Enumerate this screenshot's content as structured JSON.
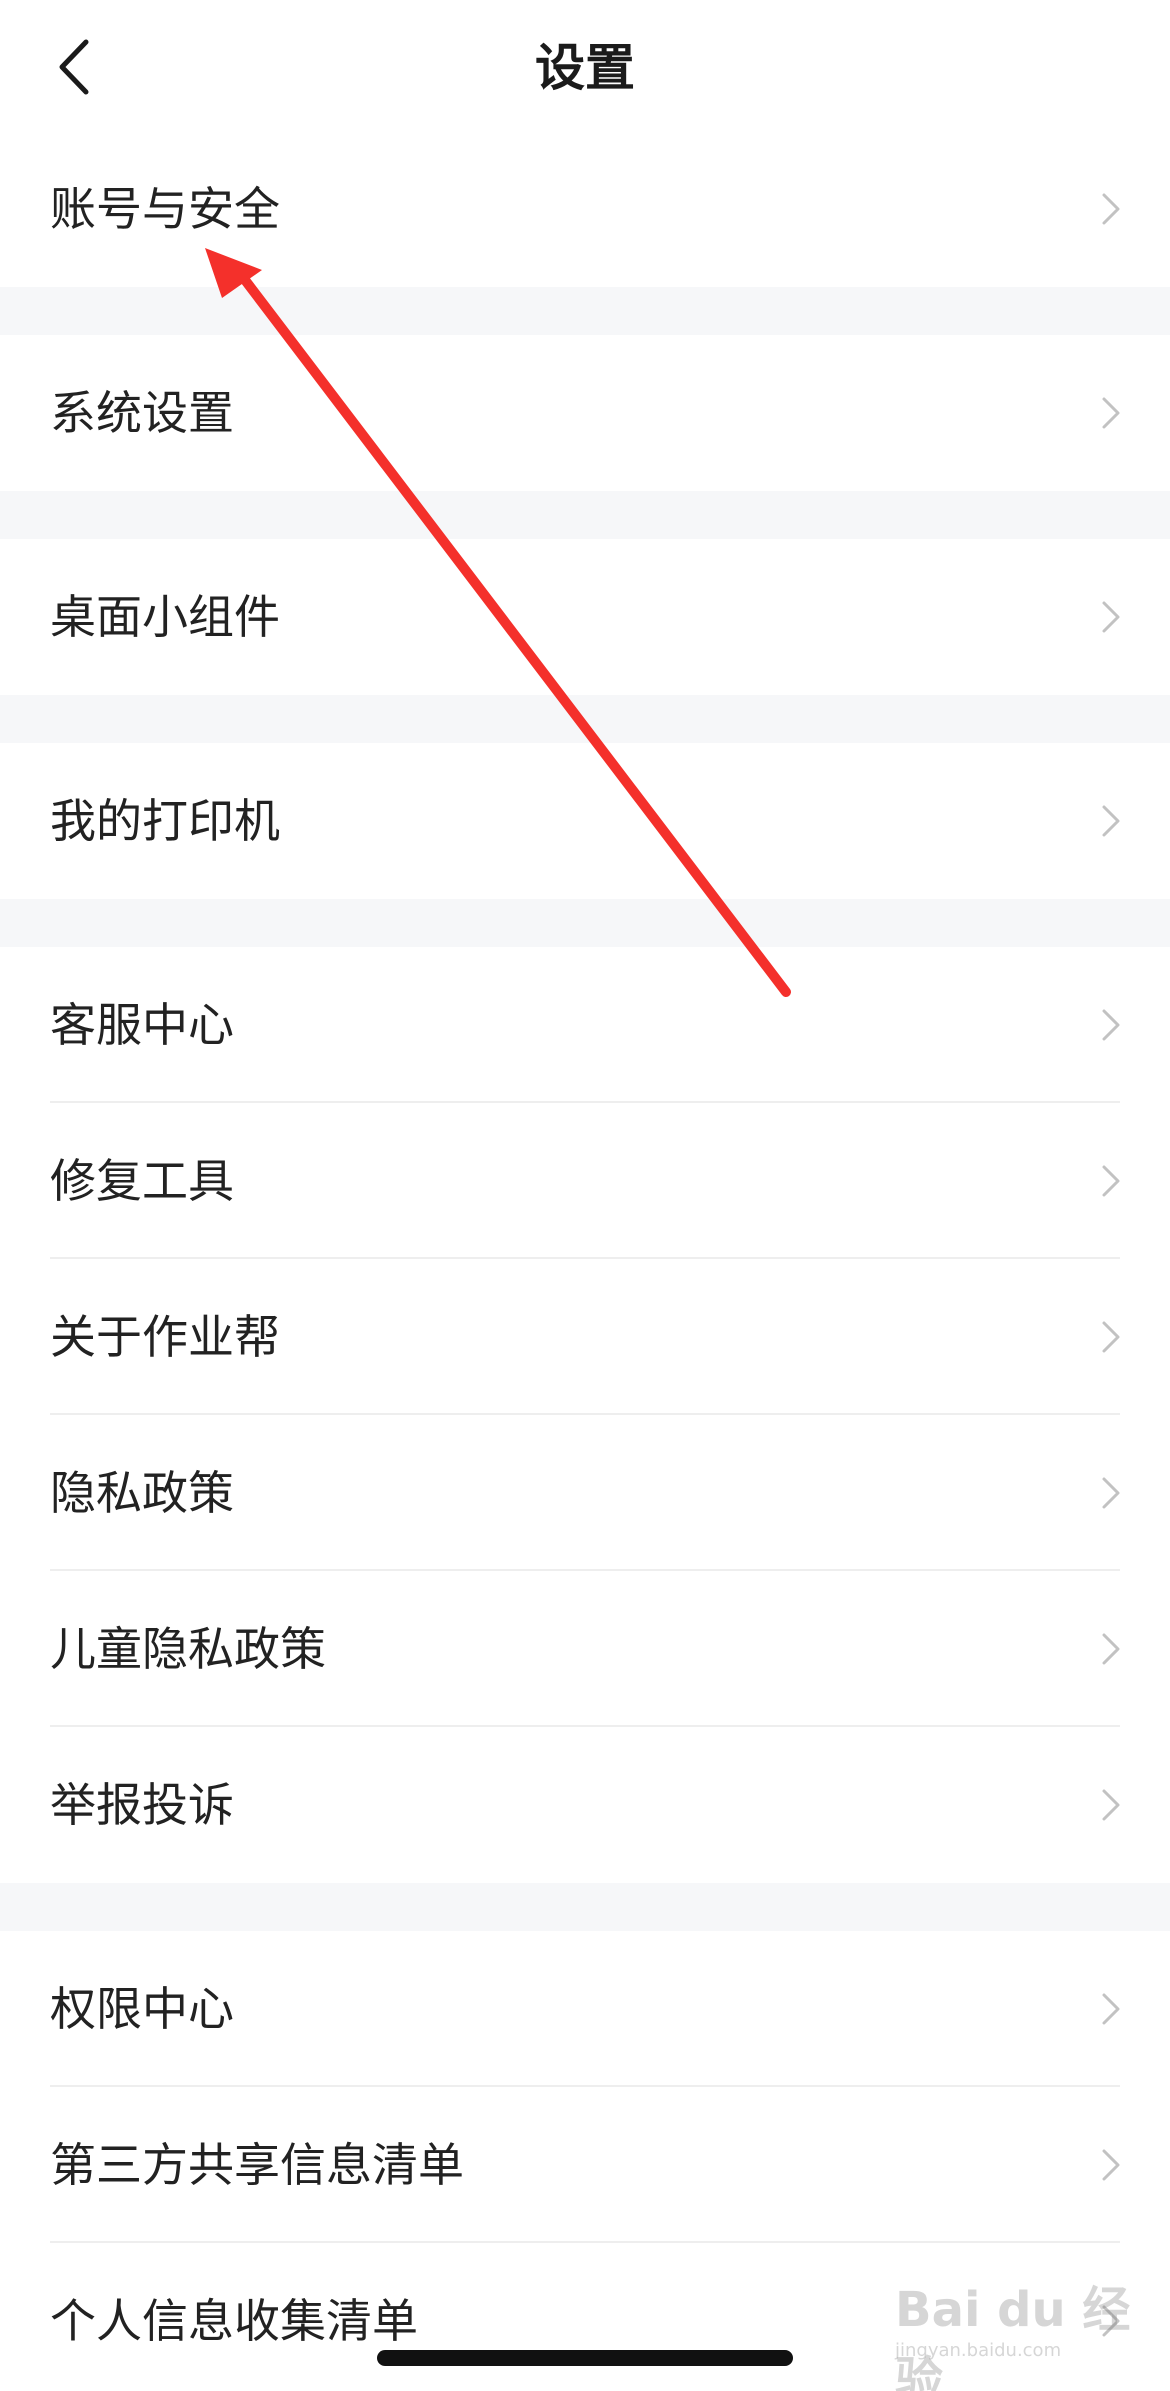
{
  "header": {
    "title": "设置"
  },
  "groups": [
    {
      "items": [
        {
          "label": "账号与安全"
        }
      ]
    },
    {
      "items": [
        {
          "label": "系统设置"
        }
      ]
    },
    {
      "items": [
        {
          "label": "桌面小组件"
        }
      ]
    },
    {
      "items": [
        {
          "label": "我的打印机"
        }
      ]
    },
    {
      "items": [
        {
          "label": "客服中心"
        },
        {
          "label": "修复工具"
        },
        {
          "label": "关于作业帮"
        },
        {
          "label": "隐私政策"
        },
        {
          "label": "儿童隐私政策"
        },
        {
          "label": "举报投诉"
        }
      ]
    },
    {
      "items": [
        {
          "label": "权限中心"
        },
        {
          "label": "第三方共享信息清单"
        },
        {
          "label": "个人信息收集清单"
        }
      ]
    }
  ],
  "watermark": {
    "logo": "Bai du 经验",
    "domain": "jingyan.baidu.com"
  },
  "colors": {
    "background": "#ffffff",
    "section_gap": "#f6f7f9",
    "text": "#222222",
    "chevron": "#c2c2c2",
    "annotation_arrow": "#f4302b"
  },
  "icons": {
    "back": "chevron-left-icon",
    "row": "chevron-right-icon"
  }
}
